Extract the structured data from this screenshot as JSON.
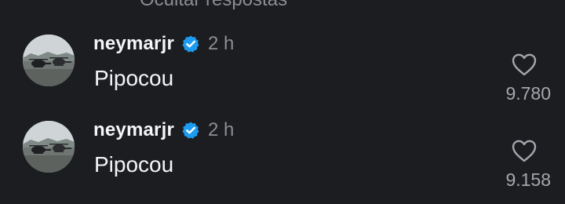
{
  "thread": {
    "hide_replies_label": "Ocultar respostas"
  },
  "comments": [
    {
      "username": "neymarjr",
      "verified": true,
      "time": "2 h",
      "text": "Pipocou",
      "likes": "9.780"
    },
    {
      "username": "neymarjr",
      "verified": true,
      "time": "2 h",
      "text": "Pipocou",
      "likes": "9.158"
    }
  ],
  "colors": {
    "background": "#1b1d21",
    "primary_text": "#f4f5f7",
    "secondary_text": "#8b8d92",
    "verified_blue": "#1d9bf0"
  },
  "icons": {
    "verified": "verified-badge-icon",
    "like": "heart-outline-icon"
  }
}
